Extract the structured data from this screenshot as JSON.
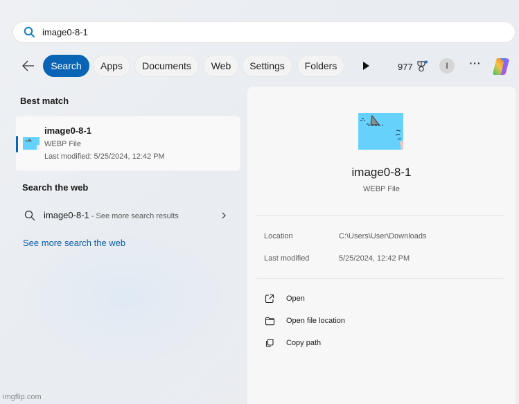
{
  "search": {
    "query": "image0-8-1"
  },
  "filters": {
    "back_label": "Back",
    "tabs": [
      {
        "label": "Search",
        "active": true
      },
      {
        "label": "Apps",
        "active": false
      },
      {
        "label": "Documents",
        "active": false
      },
      {
        "label": "Web",
        "active": false
      },
      {
        "label": "Settings",
        "active": false
      },
      {
        "label": "Folders",
        "active": false
      }
    ],
    "rewards_points": "977",
    "avatar_initial": "I",
    "more_label": "···",
    "accent_color": "#0a64b5"
  },
  "results": {
    "best_match_title": "Best match",
    "best_match": {
      "name": "image0-8-1",
      "type": "WEBP File",
      "modified": "Last modified: 5/25/2024, 12:42 PM"
    },
    "web_title": "Search the web",
    "web_item": {
      "query": "image0-8-1",
      "suffix": " - See more search results"
    },
    "see_more_link": "See more search the web"
  },
  "preview": {
    "name": "image0-8-1",
    "type": "WEBP File",
    "properties": [
      {
        "label": "Location",
        "value": "C:\\Users\\User\\Downloads"
      },
      {
        "label": "Last modified",
        "value": "5/25/2024, 12:42 PM"
      }
    ],
    "actions": [
      {
        "label": "Open",
        "icon": "open-external-icon"
      },
      {
        "label": "Open file location",
        "icon": "folder-icon"
      },
      {
        "label": "Copy path",
        "icon": "copy-icon"
      }
    ]
  },
  "watermark": "imgflip.com"
}
